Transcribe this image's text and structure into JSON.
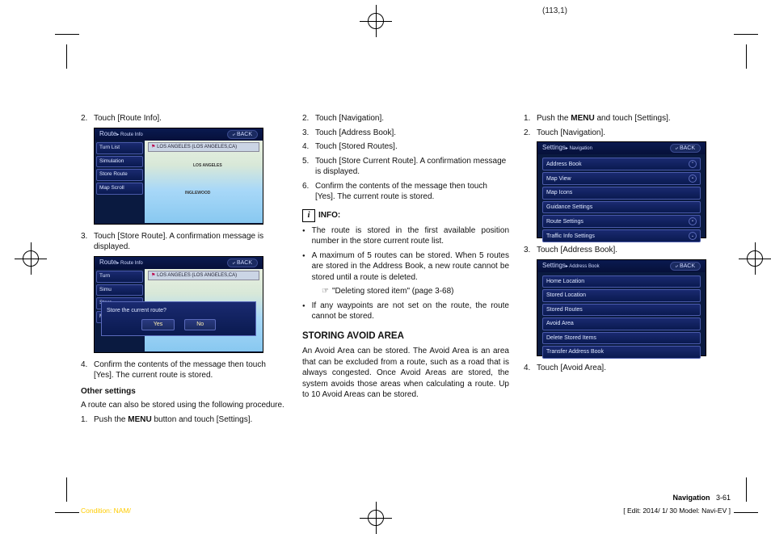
{
  "page_coord": "(113,1)",
  "col1": {
    "steps_a": [
      {
        "num": "2.",
        "text": "Touch [Route Info]."
      }
    ],
    "screen1": {
      "title": "Route",
      "subtitle": "Route Info",
      "back": "BACK",
      "menu": [
        "Turn List",
        "Simulation",
        "Store Route",
        "Map Scroll"
      ],
      "map_label": "LOS ANGELES (LOS ANGELES,CA)",
      "city1": "LOS ANGELES",
      "city2": "INGLEWOOD"
    },
    "steps_b": [
      {
        "num": "3.",
        "text": "Touch [Store Route]. A confirmation message is displayed."
      }
    ],
    "screen2": {
      "title": "Route",
      "subtitle": "Route Info",
      "back": "BACK",
      "menu": [
        "Turn",
        "Simu",
        "Store",
        "Map Scroll"
      ],
      "map_label": "LOS ANGELES (LOS ANGELES,CA)",
      "dialog_text": "Store the current route?",
      "yes": "Yes",
      "no": "No"
    },
    "steps_c": [
      {
        "num": "4.",
        "text": "Confirm the contents of the message then touch [Yes]. The current route is stored."
      }
    ],
    "other_settings_head": "Other settings",
    "other_settings_text": "A route can also be stored using the following procedure.",
    "steps_d": [
      {
        "num": "1.",
        "text_pre": "Push the ",
        "bold": "MENU",
        "text_post": " button and touch [Settings]."
      }
    ]
  },
  "col2": {
    "steps_a": [
      {
        "num": "2.",
        "text": "Touch [Navigation]."
      },
      {
        "num": "3.",
        "text": "Touch [Address Book]."
      },
      {
        "num": "4.",
        "text": "Touch [Stored Routes]."
      },
      {
        "num": "5.",
        "text": "Touch [Store Current Route]. A confirmation message is displayed."
      },
      {
        "num": "6.",
        "text": "Confirm the contents of the message then touch [Yes]. The current route is stored."
      }
    ],
    "info_label": "INFO:",
    "info_bullets": [
      "The route is stored in the first available position number in the store current route list.",
      "A maximum of 5 routes can be stored. When 5 routes are stored in the Address Book, a new route cannot be stored until a route is deleted."
    ],
    "info_ref": "\"Deleting stored item\" (page 3-68)",
    "info_bullets2": [
      "If any waypoints are not set on the route, the route cannot be stored."
    ],
    "storing_head": "STORING AVOID AREA",
    "storing_text": "An Avoid Area can be stored. The Avoid Area is an area that can be excluded from a route, such as a road that is always congested. Once Avoid Areas are stored, the system avoids those areas when calculating a route. Up to 10 Avoid Areas can be stored."
  },
  "col3": {
    "steps_a": [
      {
        "num": "1.",
        "text_pre": "Push the ",
        "bold": "MENU",
        "text_post": " and touch [Settings]."
      },
      {
        "num": "2.",
        "text": "Touch [Navigation]."
      }
    ],
    "screen1": {
      "title": "Settings",
      "subtitle": "Navigation",
      "back": "BACK",
      "items": [
        "Address Book",
        "Map View",
        "Map Icons",
        "Guidance Settings",
        "Route Settings",
        "Traffic Info Settings"
      ]
    },
    "steps_b": [
      {
        "num": "3.",
        "text": "Touch [Address Book]."
      }
    ],
    "screen2": {
      "title": "Settings",
      "subtitle": "Address Book",
      "back": "BACK",
      "items": [
        "Home Location",
        "Stored Location",
        "Stored Routes",
        "Avoid Area",
        "Delete Stored Items",
        "Transfer Address Book"
      ]
    },
    "steps_c": [
      {
        "num": "4.",
        "text": "Touch [Avoid Area]."
      }
    ]
  },
  "footer": {
    "section": "Navigation",
    "page": "3-61",
    "condition": "Condition: NAM/",
    "edit": "[ Edit: 2014/ 1/ 30   Model: Navi-EV ]"
  }
}
